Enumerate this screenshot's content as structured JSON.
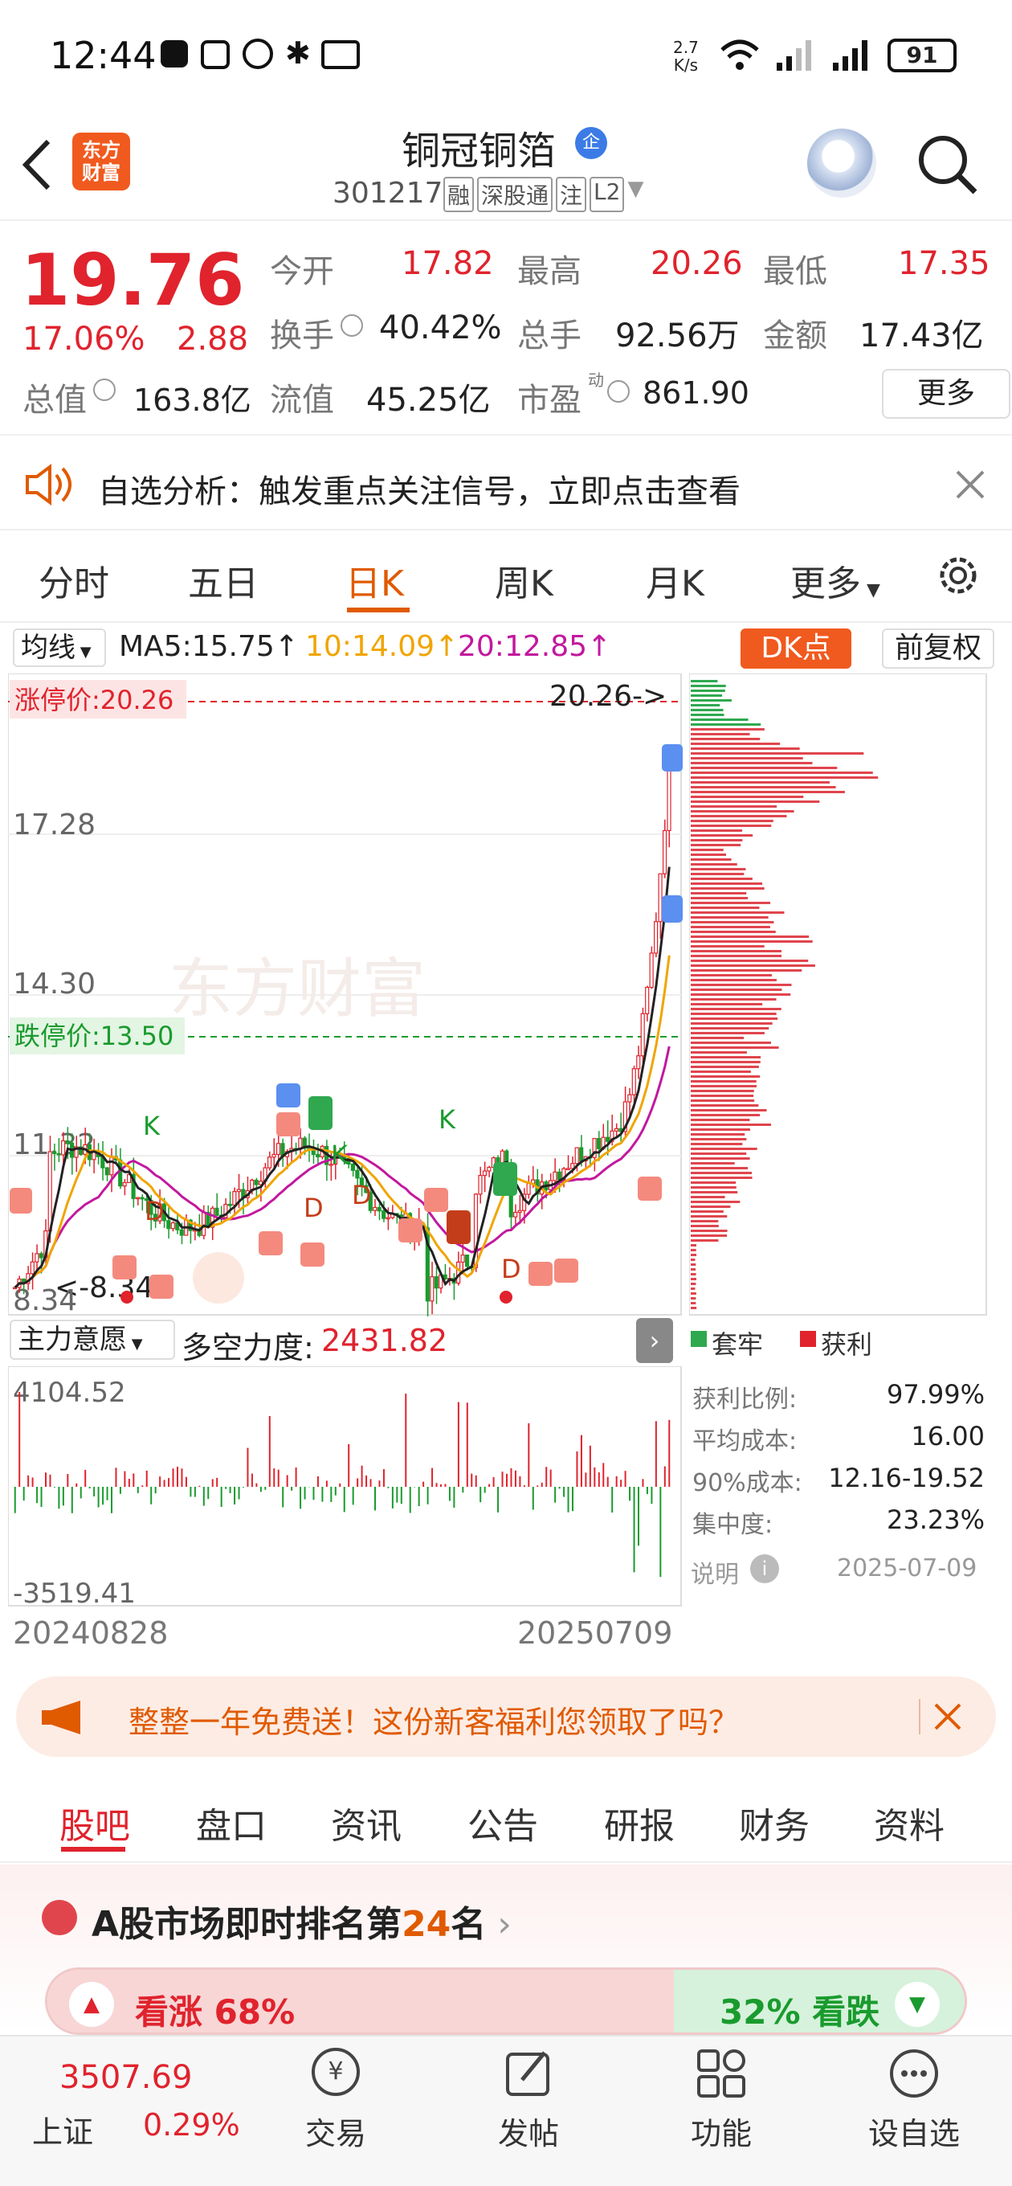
{
  "status": {
    "time": "12:44",
    "net_speed_top": "2.7",
    "net_speed_bottom": "K/s",
    "battery": "91"
  },
  "header": {
    "title": "铜冠铜箔",
    "badge": "企",
    "code": "301217",
    "tags": [
      "融",
      "深股通",
      "注",
      "L2"
    ],
    "brand_line1": "东方",
    "brand_line2": "财富"
  },
  "quote": {
    "price": "19.76",
    "pct": "17.06%",
    "change": "2.88",
    "open_label": "今开",
    "open": "17.82",
    "high_label": "最高",
    "high": "20.26",
    "low_label": "最低",
    "low": "17.35",
    "turnover_label": "换手",
    "turnover": "40.42%",
    "volume_label": "总手",
    "volume": "92.56万",
    "amount_label": "金额",
    "amount": "17.43亿",
    "mcap_label": "总值",
    "mcap": "163.8亿",
    "float_label": "流值",
    "float": "45.25亿",
    "pe_label": "市盈",
    "pe_sup": "动",
    "pe": "861.90",
    "more_btn": "更多"
  },
  "alert": {
    "text": "自选分析：触发重点关注信号，立即点击查看"
  },
  "chart_tabs": [
    "分时",
    "五日",
    "日K",
    "周K",
    "月K",
    "更多"
  ],
  "ma": {
    "selector": "均线",
    "ma5": "MA5:15.75↑",
    "ma10": "10:14.09↑",
    "ma20": "20:12.85↑",
    "dk_btn": "DK点",
    "fq_btn": "前复权"
  },
  "kchart": {
    "limit_up_label": "涨停价:20.26",
    "limit_down_label": "跌停价:13.50",
    "max_label": "20.26->",
    "min_label": "<-8.34",
    "watermark": "东方财富",
    "y_ticks": [
      "20.26",
      "17.28",
      "14.30",
      "11.32",
      "8.34"
    ]
  },
  "chips": {
    "legend_trap": "套牢",
    "legend_profit": "获利",
    "rows": [
      {
        "label": "获利比例:",
        "value": "97.99%"
      },
      {
        "label": "平均成本:",
        "value": "16.00"
      },
      {
        "label": "90%成本:",
        "value": "12.16-19.52"
      },
      {
        "label": "集中度:",
        "value": "23.23%"
      }
    ],
    "note": "说明",
    "date": "2025-07-09"
  },
  "indicator": {
    "selector": "主力意愿",
    "name": "多空力度:",
    "value": "2431.82",
    "max": "4104.52",
    "min": "-3519.41",
    "date_start": "20240828",
    "date_end": "20250709"
  },
  "promo": {
    "text": "整整一年免费送！这份新客福利您领取了吗？"
  },
  "bottom_tabs": [
    "股吧",
    "盘口",
    "资讯",
    "公告",
    "研报",
    "财务",
    "资料"
  ],
  "rank": {
    "prefix": "A股市场即时排名第",
    "num": "24",
    "suffix": "名"
  },
  "vote": {
    "up": "看涨 68%",
    "down": "32% 看跌"
  },
  "nav": {
    "index_value": "3507.69",
    "index_name": "上证",
    "index_pct": "0.29%",
    "items": [
      "交易",
      "发帖",
      "功能",
      "设自选"
    ]
  },
  "colors": {
    "up": "#e0232d",
    "down": "#1a9b2e",
    "accent": "#e05a00"
  }
}
